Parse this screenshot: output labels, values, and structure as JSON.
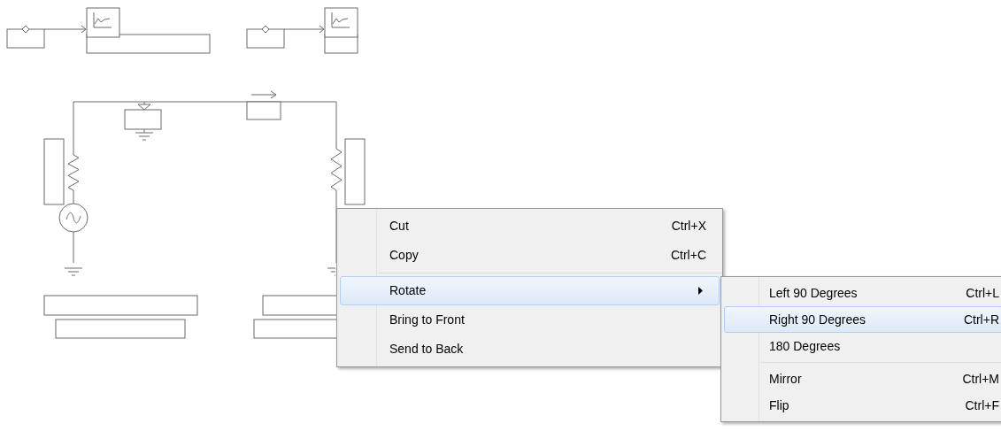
{
  "context_menu": {
    "items": [
      {
        "kind": "item",
        "label": "Cut",
        "shortcut": "Ctrl+X",
        "selected": false
      },
      {
        "kind": "item",
        "label": "Copy",
        "shortcut": "Ctrl+C",
        "selected": false
      },
      {
        "kind": "separator"
      },
      {
        "kind": "submenu",
        "label": "Rotate",
        "selected": true
      },
      {
        "kind": "item",
        "label": "Bring to Front",
        "selected": false
      },
      {
        "kind": "item",
        "label": "Send to Back",
        "selected": false
      }
    ]
  },
  "submenu": {
    "items": [
      {
        "kind": "item",
        "label": "Left 90 Degrees",
        "shortcut": "Ctrl+L",
        "selected": false
      },
      {
        "kind": "item",
        "label": "Right 90 Degrees",
        "shortcut": "Ctrl+R",
        "selected": true
      },
      {
        "kind": "item",
        "label": "180 Degrees",
        "selected": false
      },
      {
        "kind": "separator"
      },
      {
        "kind": "item",
        "label": "Mirror",
        "shortcut": "Ctrl+M",
        "selected": false
      },
      {
        "kind": "item",
        "label": "Flip",
        "shortcut": "Ctrl+F",
        "selected": false
      }
    ]
  }
}
